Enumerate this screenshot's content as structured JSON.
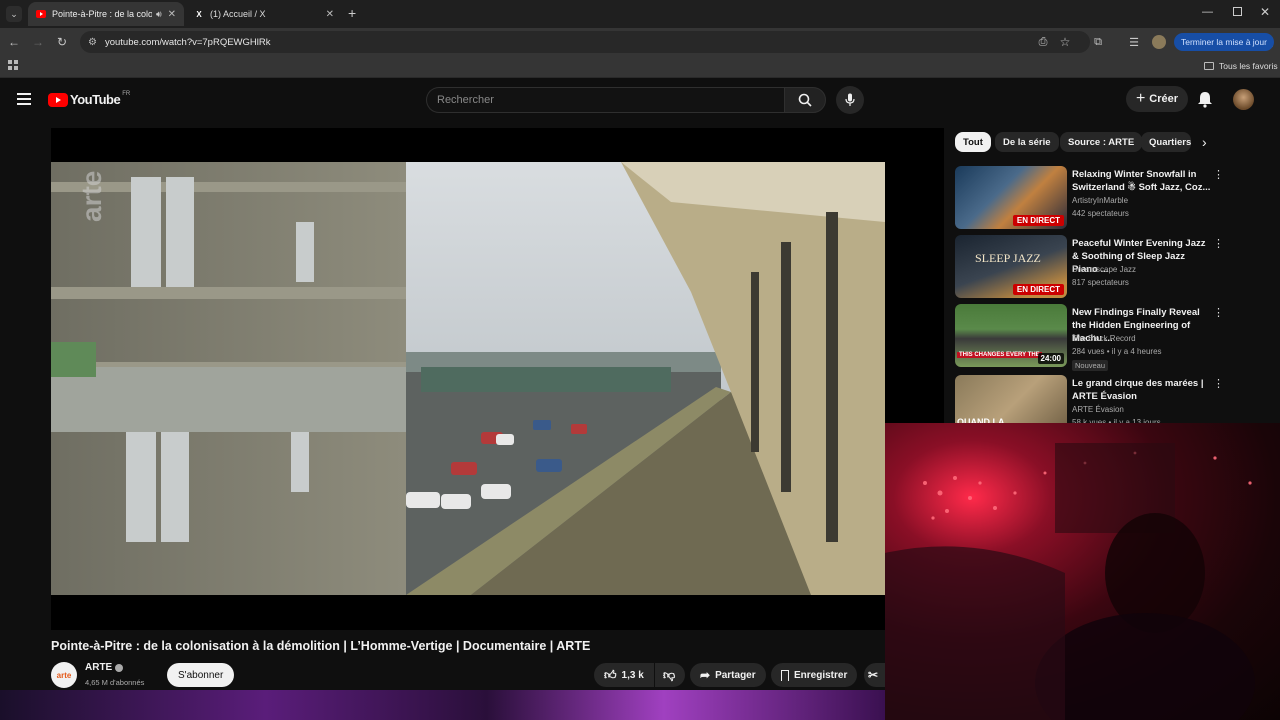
{
  "browser": {
    "tabs": [
      {
        "title": "Pointe-à-Pitre : de la colonisation",
        "active": true
      },
      {
        "title": "(1) Accueil / X",
        "active": false
      }
    ],
    "new_tab_label": "+",
    "url": "youtube.com/watch?v=7pRQEWGHlRk",
    "update_button": "Terminer la mise à jour",
    "bookmarks_label": "Tous les favoris"
  },
  "youtube": {
    "logo_text": "YouTube",
    "logo_region": "FR",
    "search_placeholder": "Rechercher",
    "create_label": "Créer"
  },
  "video": {
    "watermark": "arte",
    "title": "Pointe-à-Pitre : de la colonisation à la démolition | L’Homme-Vertige | Documentaire | ARTE",
    "channel": "ARTE",
    "channel_logo_text": "arte",
    "subscribers": "4,65 M d'abonnés",
    "subscribe_label": "S'abonner",
    "likes": "1,3 k",
    "share_label": "Partager",
    "save_label": "Enregistrer"
  },
  "chips": [
    "Tout",
    "De la série",
    "Source : ARTE",
    "Quartiers"
  ],
  "recommendations": [
    {
      "title": "Relaxing Winter Snowfall in Switzerland ☃ Soft Jazz, Coz...",
      "channel": "ArtistryInMarble",
      "meta": "442 spectateurs",
      "badge": "EN DIRECT",
      "badge_type": "live"
    },
    {
      "title": "Peaceful Winter Evening Jazz & Soothing of Sleep Jazz Piano ...",
      "channel": "Dreamscape Jazz",
      "meta": "817 spectateurs",
      "badge": "EN DIRECT",
      "badge_type": "live",
      "thumb_text": "SLEEP JAZZ"
    },
    {
      "title": "New Findings Finally Reveal the Hidden Engineering of Machu ...",
      "channel": "The Black Record",
      "meta": "284 vues • il y a 4 heures",
      "badge": "24:00",
      "badge_type": "duration",
      "extra": "Nouveau",
      "thumb_text": "THIS CHANGES EVERY THE"
    },
    {
      "title": "Le grand cirque des marées | ARTE Évasion",
      "channel": "ARTE Évasion",
      "meta": "58 k vues • il y a 13 jours",
      "thumb_text": "QUAND LA"
    }
  ],
  "colors": {
    "accent": "#ff0000",
    "live": "#cc0000",
    "update": "#174ea6"
  }
}
